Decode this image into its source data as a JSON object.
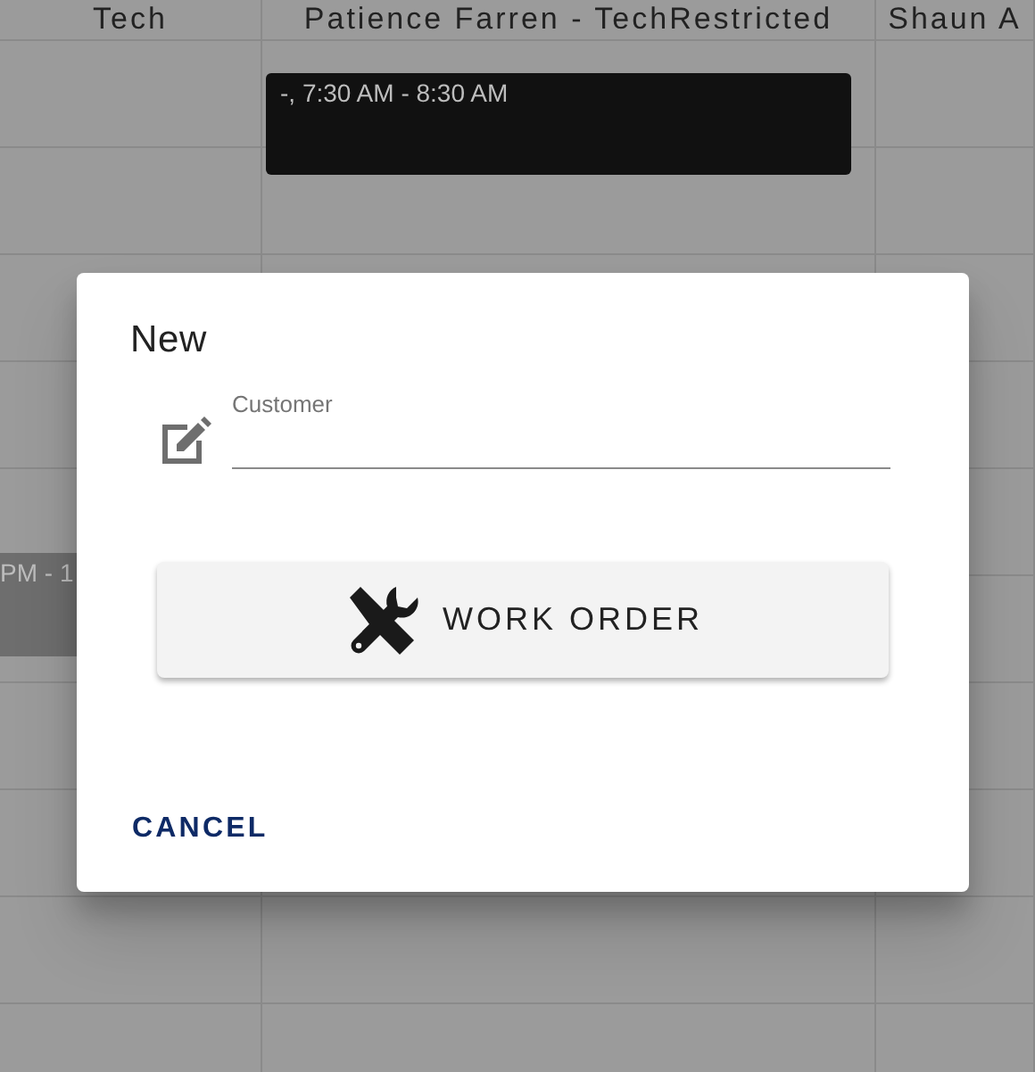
{
  "calendar": {
    "columns": [
      {
        "header": "Tech",
        "events": [
          {
            "text": "PM - 1",
            "color": "#6e6e6e"
          }
        ]
      },
      {
        "header": "Patience Farren - TechRestricted",
        "events": [
          {
            "text": "-, 7:30 AM - 8:30 AM",
            "color": "#111111"
          }
        ]
      },
      {
        "header": "Shaun A"
      }
    ]
  },
  "dialog": {
    "title": "New",
    "customer_field": {
      "label": "Customer"
    },
    "action_button": "WORK ORDER",
    "cancel_button": "CANCEL"
  }
}
